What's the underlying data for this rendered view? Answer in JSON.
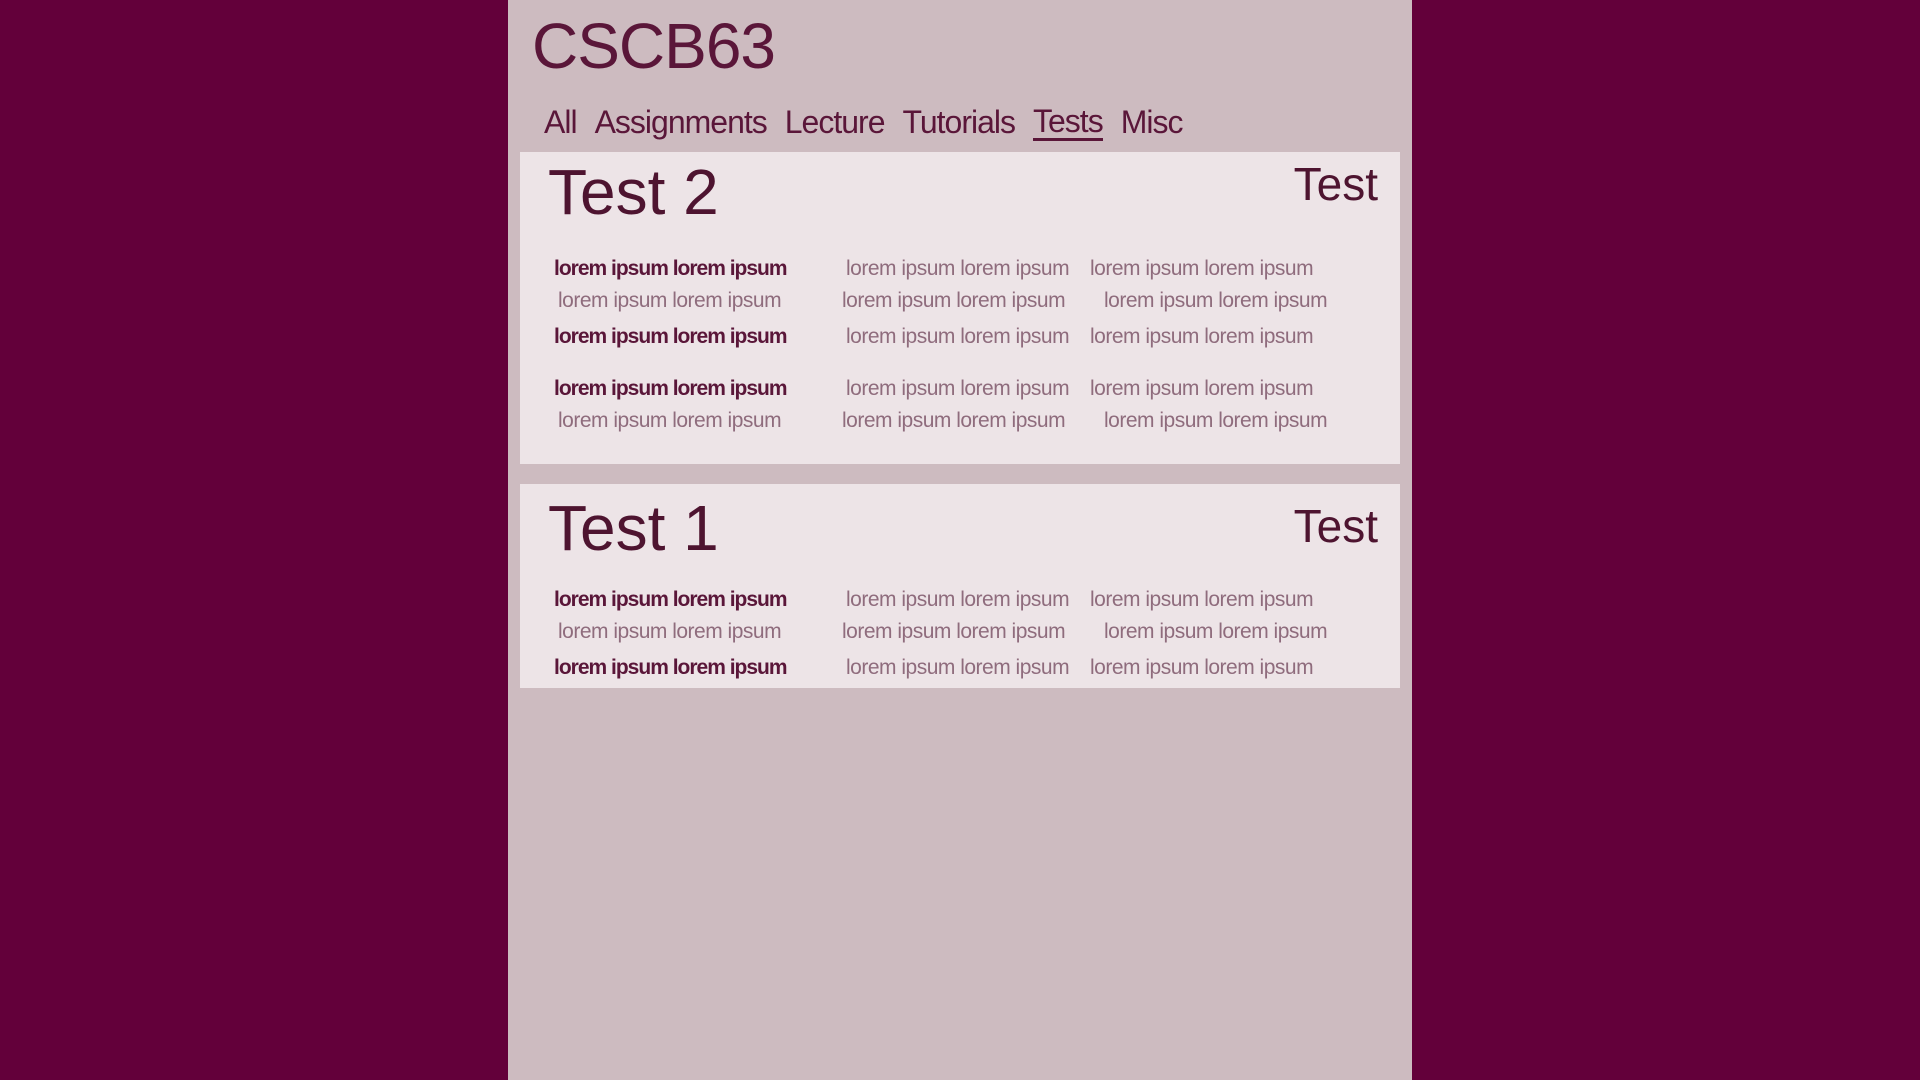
{
  "header": {
    "course_code": "CSCB63"
  },
  "nav": {
    "tabs": [
      {
        "label": "All",
        "active": false
      },
      {
        "label": "Assignments",
        "active": false
      },
      {
        "label": "Lecture",
        "active": false
      },
      {
        "label": "Tutorials",
        "active": false
      },
      {
        "label": "Tests",
        "active": true
      },
      {
        "label": "Misc",
        "active": false
      }
    ]
  },
  "cards": [
    {
      "title": "Test 2",
      "type": "Test",
      "rows": [
        [
          "lorem ipsum lorem ipsum",
          "lorem ipsum lorem ipsum",
          "lorem ipsum lorem ipsum"
        ],
        [
          "lorem ipsum lorem ipsum",
          "lorem ipsum lorem ipsum",
          "lorem ipsum lorem ipsum"
        ],
        [
          "lorem ipsum lorem ipsum",
          "lorem ipsum lorem ipsum",
          "lorem ipsum lorem ipsum"
        ],
        [
          "lorem ipsum lorem ipsum",
          "lorem ipsum lorem ipsum",
          "lorem ipsum lorem ipsum"
        ],
        [
          "lorem ipsum lorem ipsum",
          "lorem ipsum lorem ipsum",
          "lorem ipsum lorem ipsum"
        ]
      ]
    },
    {
      "title": "Test 1",
      "type": "Test",
      "rows": [
        [
          "lorem ipsum lorem ipsum",
          "lorem ipsum lorem ipsum",
          "lorem ipsum lorem ipsum"
        ],
        [
          "lorem ipsum lorem ipsum",
          "lorem ipsum lorem ipsum",
          "lorem ipsum lorem ipsum"
        ],
        [
          "lorem ipsum lorem ipsum",
          "lorem ipsum lorem ipsum",
          "lorem ipsum lorem ipsum"
        ]
      ]
    }
  ],
  "colors": {
    "outer_background": "#63003a",
    "page_background": "#cdbbc0",
    "card_background": "#ede4e7",
    "primary_text": "#5a1639",
    "muted_text": "#8f6c7d"
  }
}
